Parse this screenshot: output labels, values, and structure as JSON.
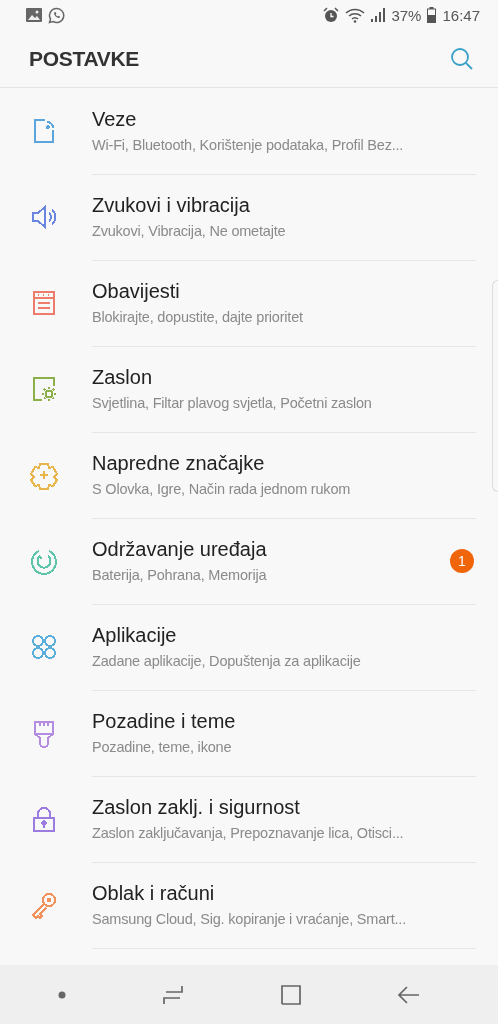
{
  "status_bar": {
    "battery": "37%",
    "time": "16:47"
  },
  "header": {
    "title": "POSTAVKE"
  },
  "items": [
    {
      "kind": "connections",
      "color": "#5aa6dc",
      "title": "Veze",
      "subtitle": "Wi-Fi, Bluetooth, Korištenje podataka, Profil Bez..."
    },
    {
      "kind": "sound",
      "color": "#6b86e0",
      "title": "Zvukovi i vibracija",
      "subtitle": "Zvukovi, Vibracija, Ne ometajte"
    },
    {
      "kind": "notifications",
      "color": "#ee7c6c",
      "title": "Obavijesti",
      "subtitle": "Blokirajte, dopustite, dajte prioritet"
    },
    {
      "kind": "display",
      "color": "#8cb04a",
      "title": "Zaslon",
      "subtitle": "Svjetlina, Filtar plavog svjetla, Početni zaslon"
    },
    {
      "kind": "advanced",
      "color": "#e8b44c",
      "title": "Napredne značajke",
      "subtitle": "S Olovka, Igre, Način rada jednom rukom"
    },
    {
      "kind": "maintenance",
      "color": "#5cc4a8",
      "title": "Održavanje uređaja",
      "subtitle": "Baterija, Pohrana, Memorija",
      "badge": "1"
    },
    {
      "kind": "apps",
      "color": "#5aaedc",
      "title": "Aplikacije",
      "subtitle": "Zadane aplikacije, Dopuštenja za aplikacije"
    },
    {
      "kind": "wallpaper",
      "color": "#b48ce0",
      "title": "Pozadine i teme",
      "subtitle": "Pozadine, teme, ikone"
    },
    {
      "kind": "lock",
      "color": "#9c7ce0",
      "title": "Zaslon zaklj. i sigurnost",
      "subtitle": "Zaslon zaključavanja, Prepoznavanje lica, Otisci..."
    },
    {
      "kind": "accounts",
      "color": "#f0925a",
      "title": "Oblak i računi",
      "subtitle": "Samsung Cloud, Sig. kopiranje i vraćanje, Smart..."
    }
  ]
}
